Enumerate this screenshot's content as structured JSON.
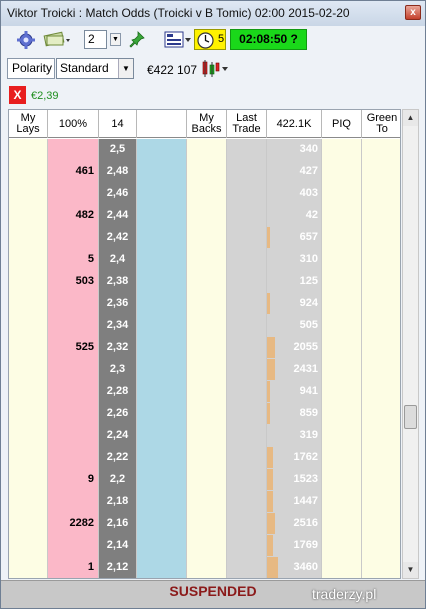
{
  "window": {
    "title": "Viktor Troicki : Match Odds (Troicki v B Tomic) 02:00 2015-02-20",
    "close_label": "x"
  },
  "toolbar": {
    "stake_step": "2",
    "clock_count": "5",
    "timer": "02:08:50 ?"
  },
  "polarity": {
    "label": "Polarity",
    "selected": "Standard"
  },
  "liability": "€422 107",
  "profit": {
    "close_label": "X",
    "value": "€2,39"
  },
  "ladder": {
    "headers": {
      "my_lays": "My Lays",
      "lay_pct": "100%",
      "price_col": "14",
      "back_col": "",
      "my_backs": "My Backs",
      "last_trade": "Last Trade",
      "volume": "422.1K",
      "piq": "PIQ",
      "green_to": "Green To"
    },
    "rows": [
      {
        "price": "2,5",
        "lay": "",
        "volume": "340",
        "vol_frac": 0.0
      },
      {
        "price": "2,48",
        "lay": "461",
        "volume": "427",
        "vol_frac": 0.0
      },
      {
        "price": "2,46",
        "lay": "",
        "volume": "403",
        "vol_frac": 0.0
      },
      {
        "price": "2,44",
        "lay": "482",
        "volume": "42",
        "vol_frac": 0.0
      },
      {
        "price": "2,42",
        "lay": "",
        "volume": "657",
        "vol_frac": 0.05
      },
      {
        "price": "2,4",
        "lay": "5",
        "volume": "310",
        "vol_frac": 0.0
      },
      {
        "price": "2,38",
        "lay": "503",
        "volume": "125",
        "vol_frac": 0.0
      },
      {
        "price": "2,36",
        "lay": "",
        "volume": "924",
        "vol_frac": 0.05
      },
      {
        "price": "2,34",
        "lay": "",
        "volume": "505",
        "vol_frac": 0.0
      },
      {
        "price": "2,32",
        "lay": "525",
        "volume": "2055",
        "vol_frac": 0.15
      },
      {
        "price": "2,3",
        "lay": "",
        "volume": "2431",
        "vol_frac": 0.15
      },
      {
        "price": "2,28",
        "lay": "",
        "volume": "941",
        "vol_frac": 0.05
      },
      {
        "price": "2,26",
        "lay": "",
        "volume": "859",
        "vol_frac": 0.05
      },
      {
        "price": "2,24",
        "lay": "",
        "volume": "319",
        "vol_frac": 0.0
      },
      {
        "price": "2,22",
        "lay": "",
        "volume": "1762",
        "vol_frac": 0.1
      },
      {
        "price": "2,2",
        "lay": "9",
        "volume": "1523",
        "vol_frac": 0.1
      },
      {
        "price": "2,18",
        "lay": "",
        "volume": "1447",
        "vol_frac": 0.1
      },
      {
        "price": "2,16",
        "lay": "2282",
        "volume": "2516",
        "vol_frac": 0.15
      },
      {
        "price": "2,14",
        "lay": "",
        "volume": "1769",
        "vol_frac": 0.1
      },
      {
        "price": "2,12",
        "lay": "1",
        "volume": "3460",
        "vol_frac": 0.2
      }
    ]
  },
  "status": "SUSPENDED",
  "watermark": "traderzy.pl",
  "colors": {
    "lay": "#fbb8c8",
    "back": "#add8e6",
    "price": "#7f7f7f",
    "timer": "#1ad81a",
    "clock": "#fff200",
    "volume_bar": "#e7b983",
    "status_text": "#8b1a1a"
  }
}
